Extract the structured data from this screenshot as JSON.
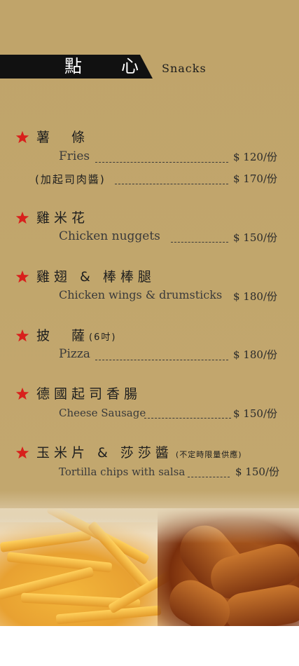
{
  "header": {
    "title": "點 心",
    "subtitle": "Snacks"
  },
  "items": [
    {
      "zh": "薯　條",
      "en": "Fries",
      "price": "$ 120/份",
      "extra": {
        "zh": "(加起司肉醬)",
        "price": "$ 170/份"
      }
    },
    {
      "zh": "雞米花",
      "en": "Chicken nuggets",
      "price": "$ 150/份"
    },
    {
      "zh": "雞翅 & 棒棒腿",
      "en": "Chicken wings & drumsticks",
      "price": "$ 180/份"
    },
    {
      "zh": "披　薩",
      "zh_note": "(6吋)",
      "en": "Pizza",
      "price": "$ 180/份"
    },
    {
      "zh": "德國起司香腸",
      "en": "Cheese Sausage",
      "price": "$ 150/份"
    },
    {
      "zh": "玉米片 & 莎莎醬",
      "zh_note": "(不定時限量供應)",
      "en": "Tortilla chips with salsa",
      "price": "$ 150/份"
    }
  ],
  "colors": {
    "background": "#c0a46a",
    "star": "#d8201c",
    "header_bar": "#111111"
  },
  "icons": {
    "bullet": "star-icon"
  }
}
